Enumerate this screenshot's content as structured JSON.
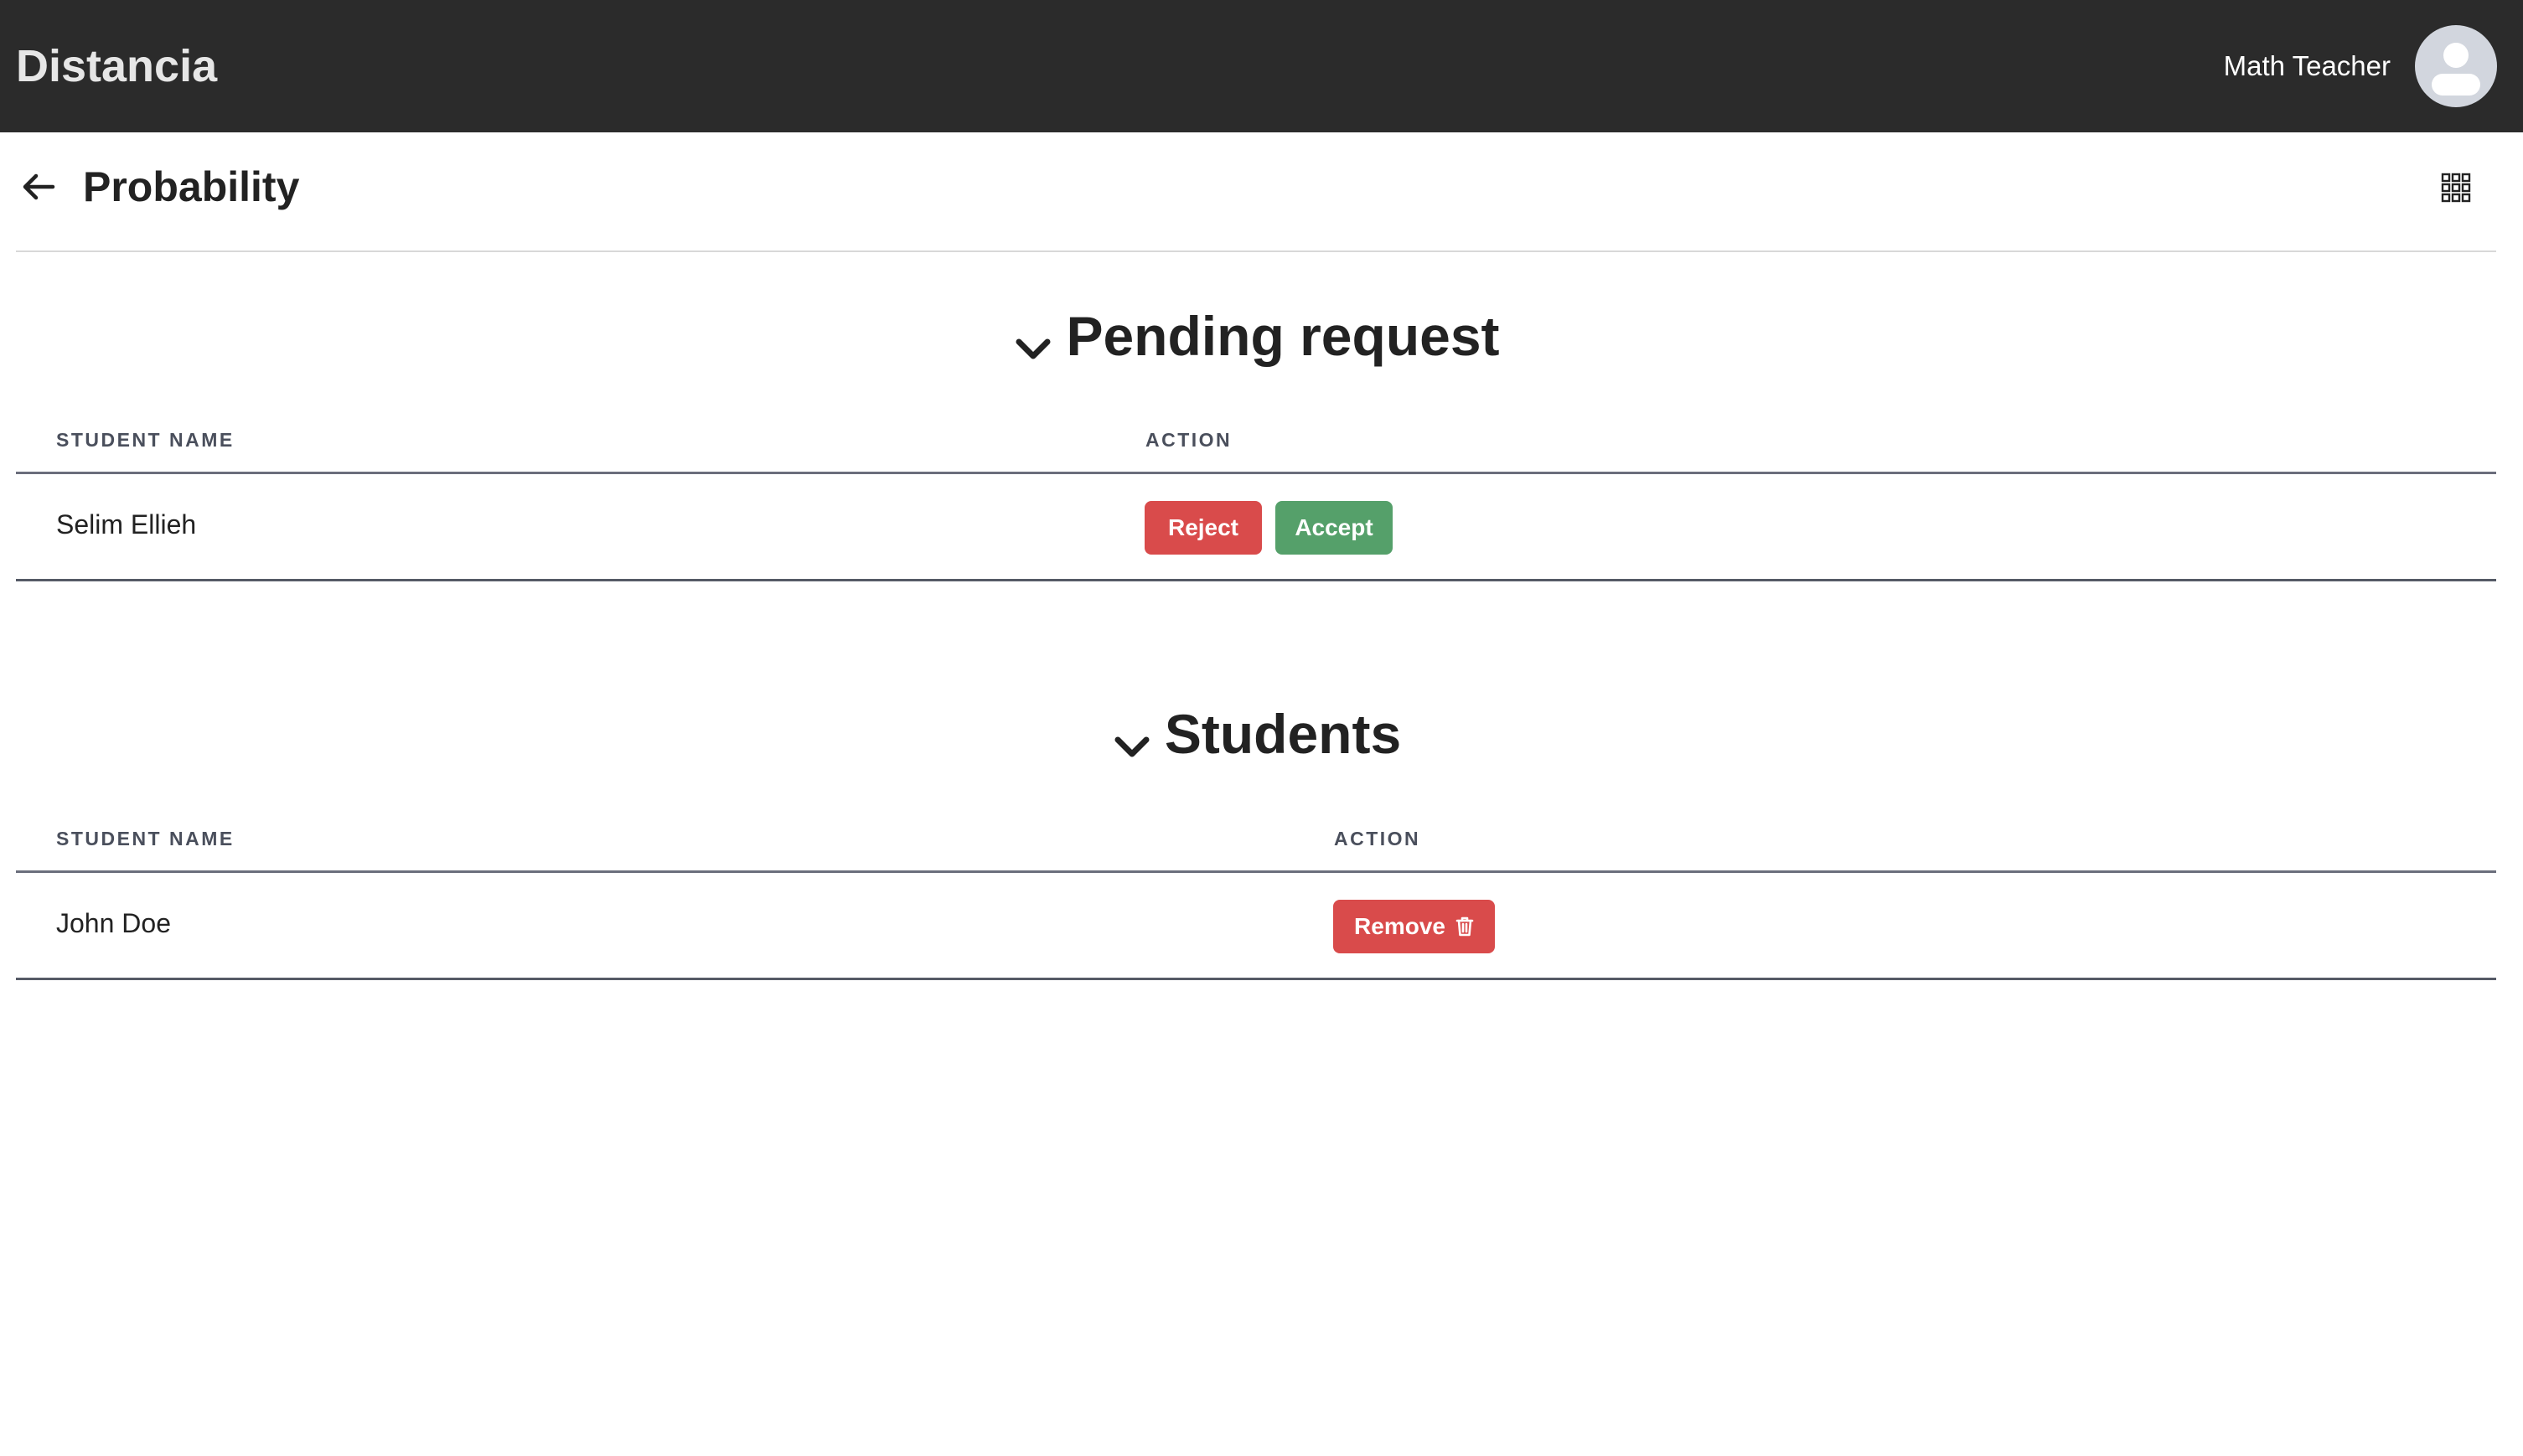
{
  "app": {
    "brand": "Distancia",
    "user_name": "Math Teacher"
  },
  "page": {
    "title": "Probability"
  },
  "pending": {
    "heading": "Pending request",
    "columns": [
      "STUDENT NAME",
      "ACTION"
    ],
    "rows": [
      {
        "name": "Selim Ellieh",
        "reject_label": "Reject",
        "accept_label": "Accept"
      }
    ]
  },
  "students": {
    "heading": "Students",
    "columns": [
      "STUDENT NAME",
      "ACTION"
    ],
    "rows": [
      {
        "name": "John Doe",
        "remove_label": "Remove"
      }
    ]
  },
  "icons": {
    "back": "arrow-left-icon",
    "apps": "grid-icon",
    "avatar": "user-avatar-icon",
    "collapse": "chevron-down-icon",
    "delete": "trash-icon"
  },
  "colors": {
    "topbar": "#2b2b2b",
    "danger": "#d94b4b",
    "success": "#55a06a"
  }
}
